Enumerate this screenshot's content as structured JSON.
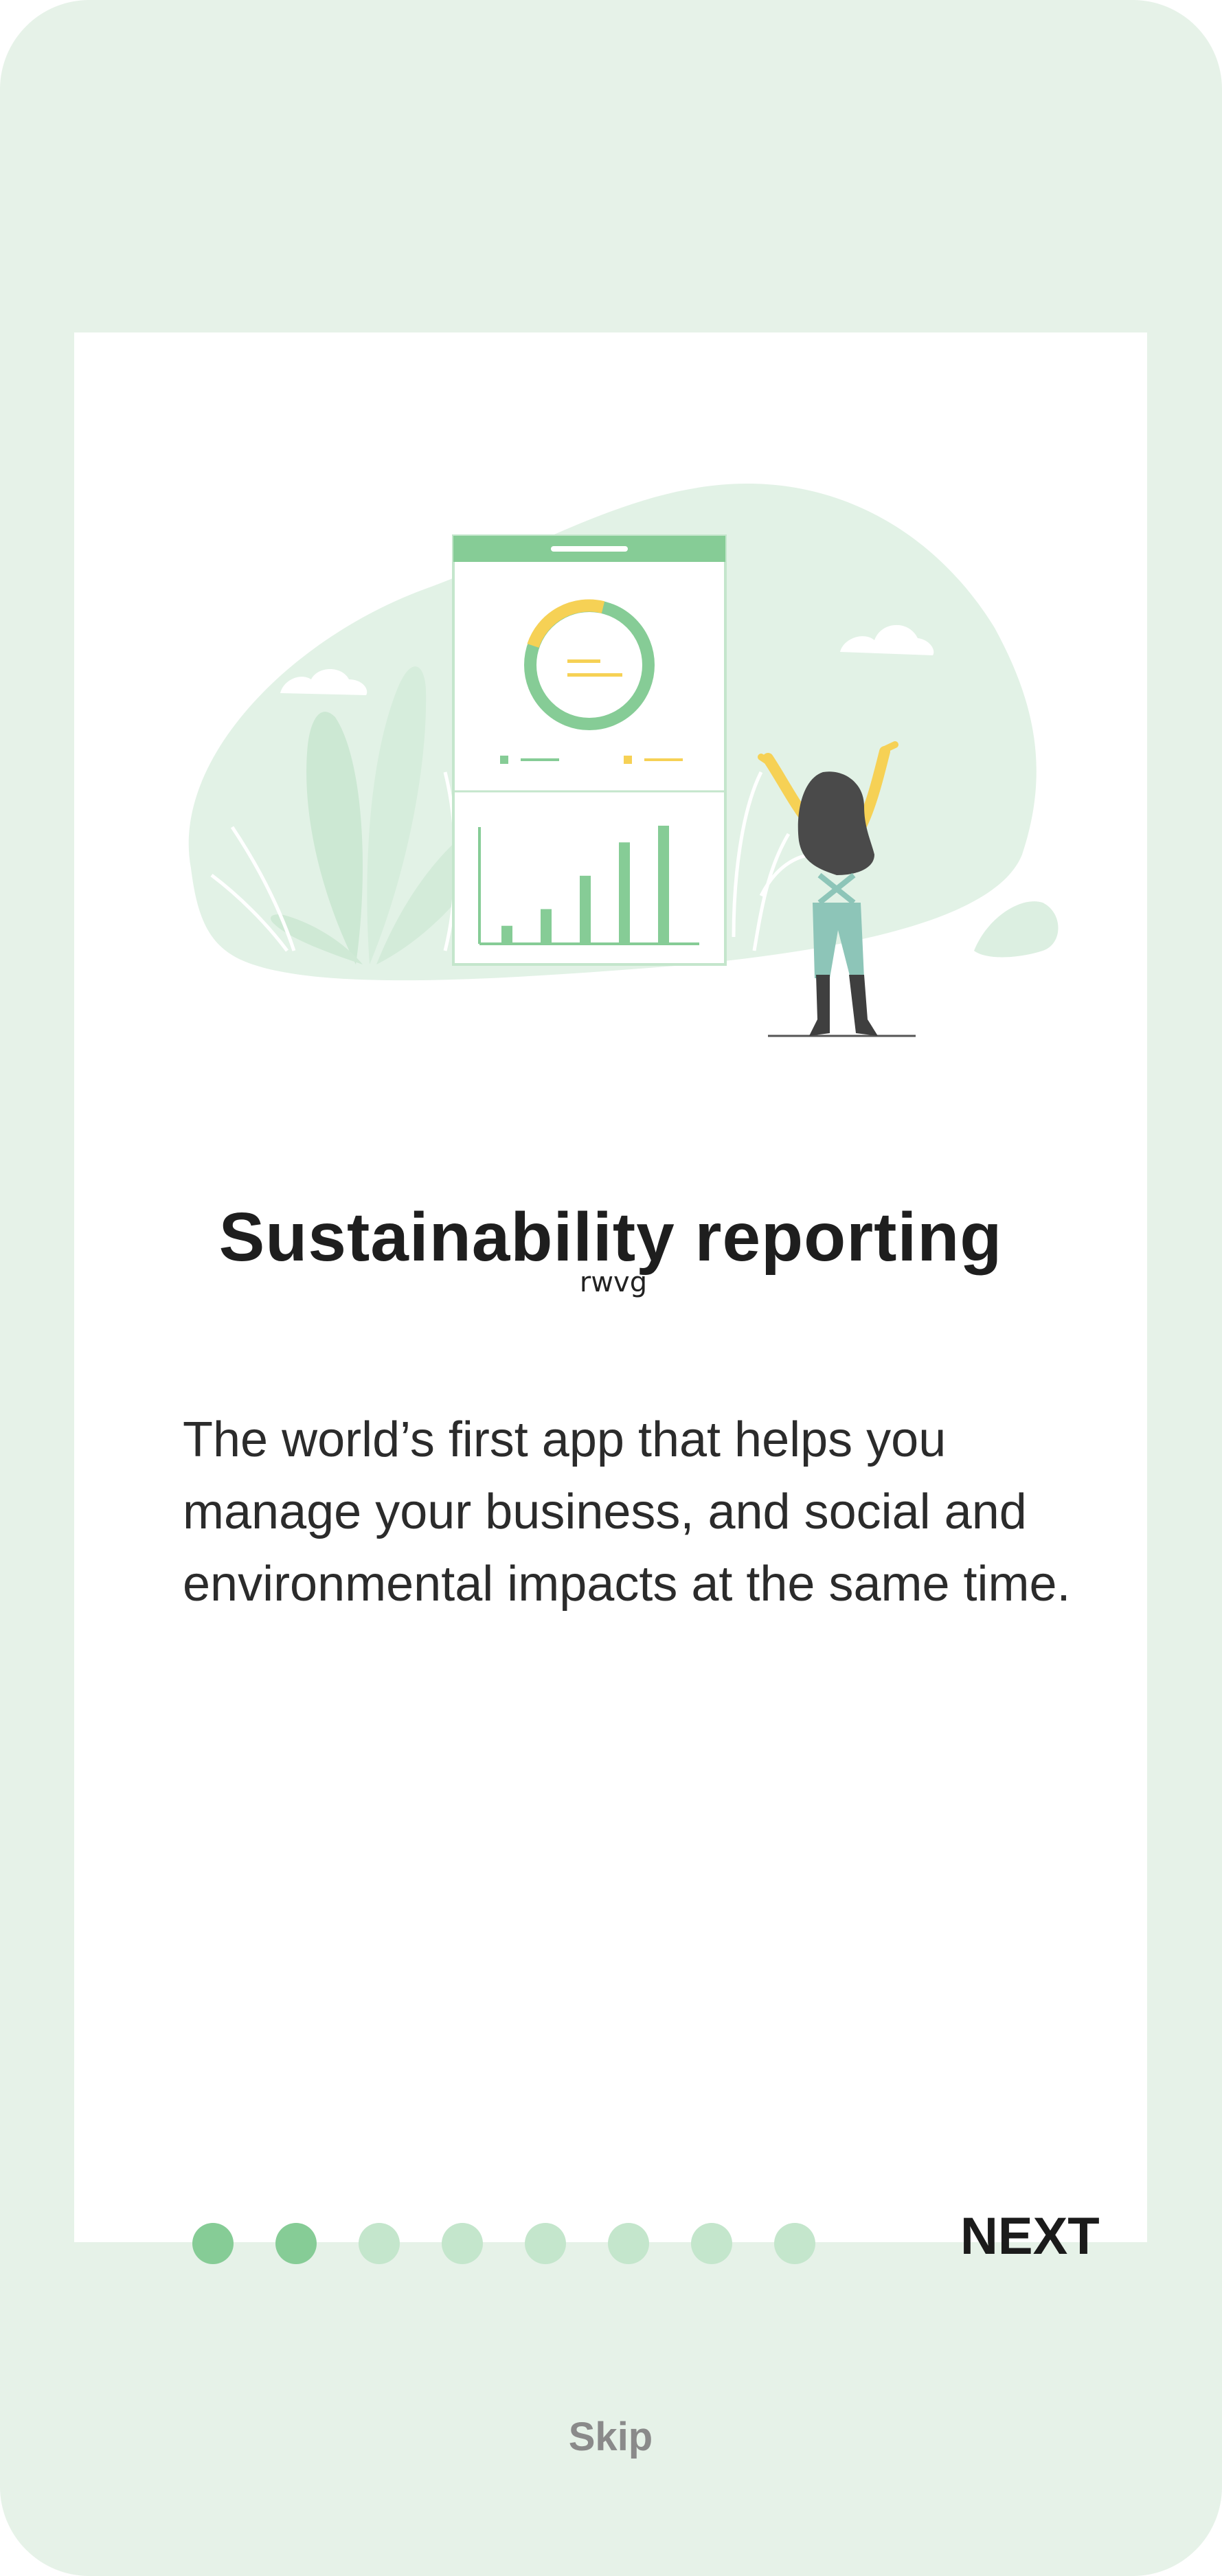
{
  "onboarding": {
    "title": "Sustainability reporting",
    "title_overlay_text": "rwvg",
    "description": "The world’s first app that helps you manage your business, and social and environmental impacts at the same time.",
    "pager": {
      "total_pages": 8,
      "active_pages": 2
    },
    "next_label": "NEXT",
    "skip_label": "Skip"
  },
  "illustration": {
    "chart_bar_values": [
      1,
      2,
      4,
      6,
      7
    ]
  },
  "colors": {
    "background": "#e6f2e8",
    "card": "#ffffff",
    "accent_green": "#86cc96",
    "light_green": "#c4e6cc",
    "yellow": "#f6d155",
    "teal": "#8dc5b8",
    "dark": "#404040"
  }
}
